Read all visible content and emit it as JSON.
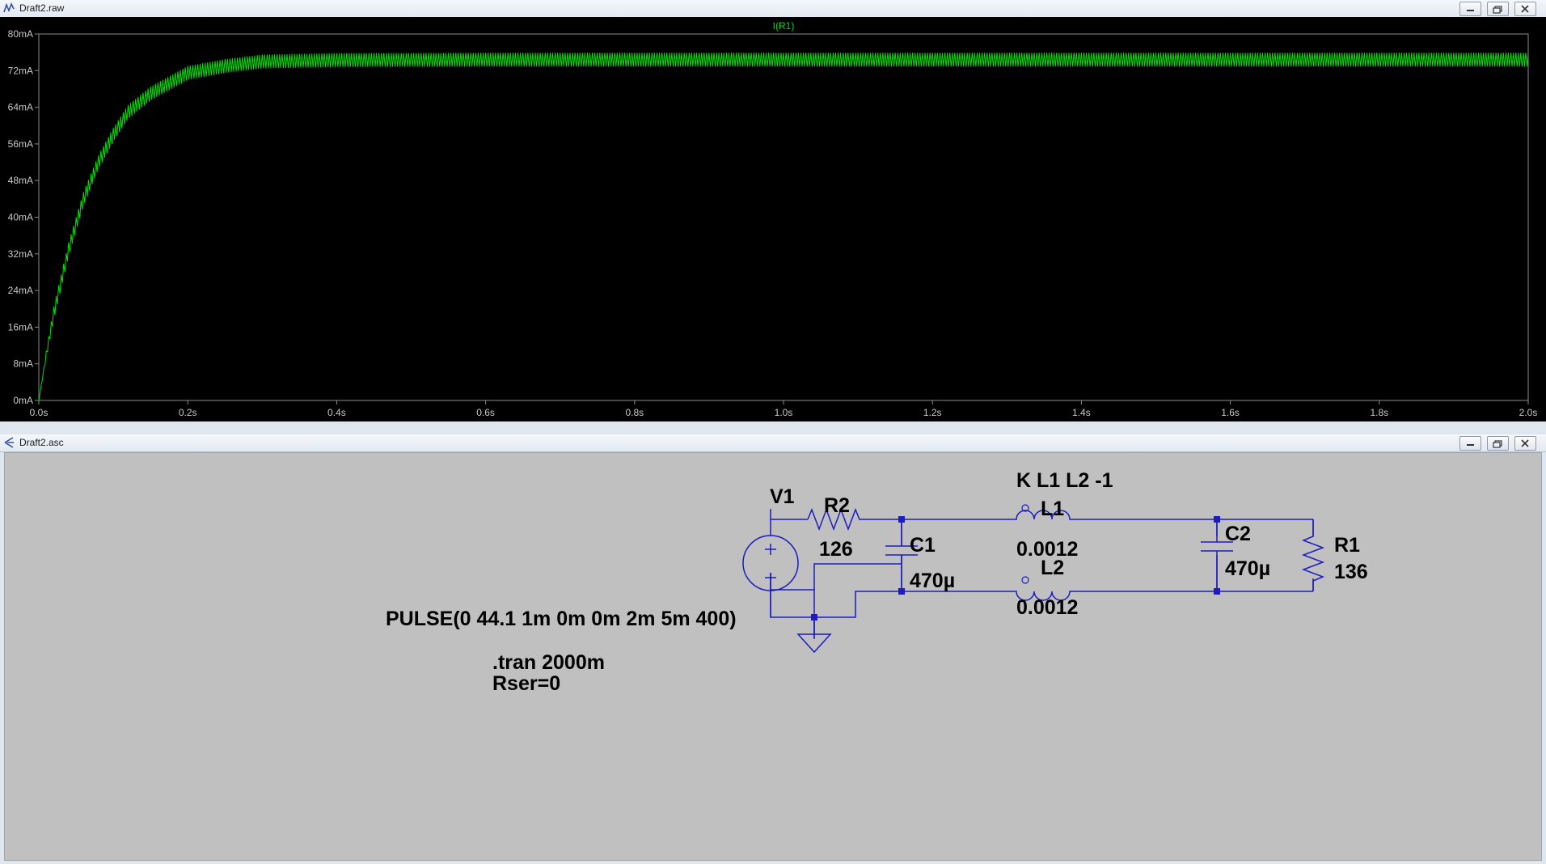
{
  "plot_window": {
    "title": "Draft2.raw"
  },
  "schematic_window": {
    "title": "Draft2.asc"
  },
  "chart_data": {
    "type": "line",
    "title": "I(R1)",
    "xlabel": "",
    "ylabel": "",
    "xlim": [
      0,
      2.0
    ],
    "ylim": [
      0,
      80
    ],
    "x_ticks": [
      "0.0s",
      "0.2s",
      "0.4s",
      "0.6s",
      "0.8s",
      "1.0s",
      "1.2s",
      "1.4s",
      "1.6s",
      "1.8s",
      "2.0s"
    ],
    "y_ticks": [
      "0mA",
      "8mA",
      "16mA",
      "24mA",
      "32mA",
      "40mA",
      "48mA",
      "56mA",
      "64mA",
      "72mA",
      "80mA"
    ],
    "series": [
      {
        "name": "I(R1)",
        "color": "#00e000",
        "x": [
          0,
          0.01,
          0.02,
          0.04,
          0.06,
          0.08,
          0.1,
          0.12,
          0.15,
          0.2,
          0.25,
          0.3,
          0.4,
          0.6,
          0.8,
          1.0,
          1.2,
          1.4,
          1.6,
          1.8,
          2.0
        ],
        "y": [
          0,
          10,
          19,
          33,
          44,
          52,
          58,
          63,
          67,
          71.5,
          73,
          74,
          74.3,
          74.4,
          74.4,
          74.4,
          74.4,
          74.4,
          74.4,
          74.4,
          74.4
        ],
        "ripple_mA": 3
      }
    ],
    "grid": false,
    "background": "#000000"
  },
  "schematic": {
    "wire_color": "#1c1cc0",
    "components": {
      "v1_name": "V1",
      "v1_value": "PULSE(0 44.1 1m 0m 0m 2m 5m 400)",
      "r2_name": "R2",
      "r2_value": "126",
      "c1_name": "C1",
      "c1_value": "470µ",
      "l1_name": "L1",
      "l1_value": "0.0012",
      "l2_name": "L2",
      "l2_value": "0.0012",
      "c2_name": "C2",
      "c2_value": "470µ",
      "r1_name": "R1",
      "r1_value": "136"
    },
    "directives": {
      "coupling": "K L1 L2 -1",
      "tran": ".tran 2000m",
      "rser": "Rser=0"
    }
  }
}
